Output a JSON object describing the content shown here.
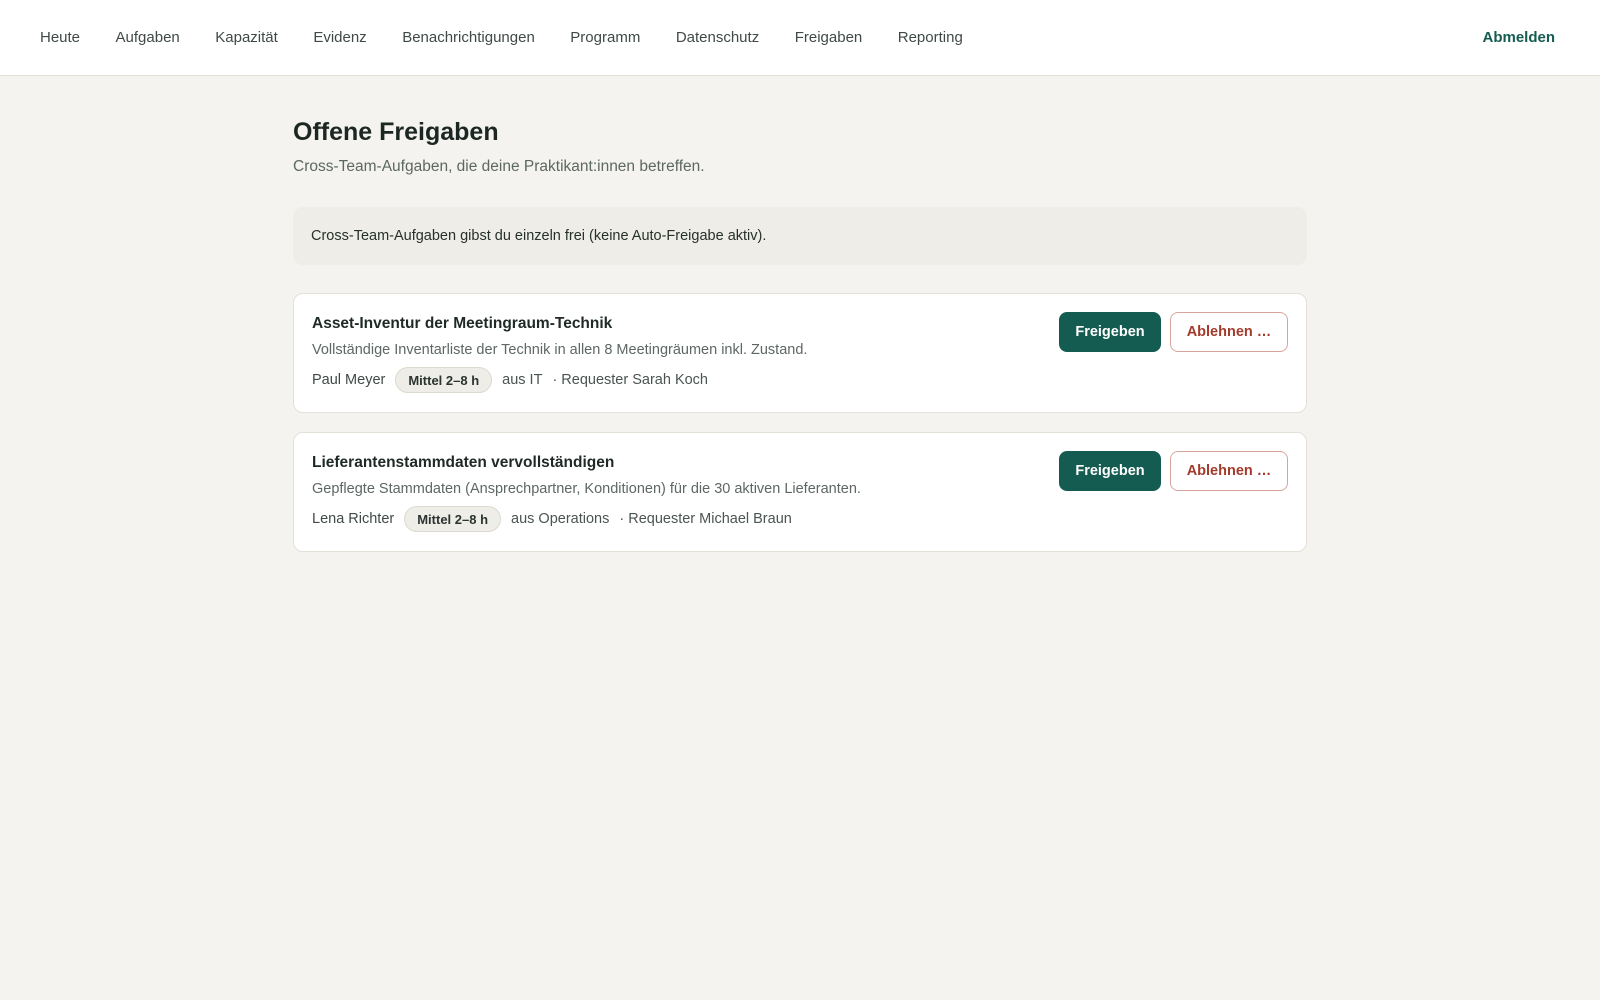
{
  "nav": {
    "items": [
      {
        "label": "Heute"
      },
      {
        "label": "Aufgaben"
      },
      {
        "label": "Kapazität"
      },
      {
        "label": "Evidenz"
      },
      {
        "label": "Benachrichtigungen"
      },
      {
        "label": "Programm"
      },
      {
        "label": "Datenschutz"
      },
      {
        "label": "Freigaben"
      },
      {
        "label": "Reporting"
      }
    ],
    "logout_label": "Abmelden"
  },
  "page": {
    "title": "Offene Freigaben",
    "subtitle": "Cross-Team-Aufgaben, die deine Praktikant:innen betreffen.",
    "notice": "Cross-Team-Aufgaben gibst du einzeln frei (keine Auto-Freigabe aktiv)."
  },
  "requests": [
    {
      "title": "Asset-Inventur der Meetingraum-Technik",
      "description": "Vollständige Inventarliste der Technik in allen 8 Meetingräumen inkl. Zustand.",
      "person": "Paul Meyer",
      "effort": "Mittel 2–8 h",
      "department": "aus IT",
      "requester": "· Requester Sarah Koch",
      "approve_label": "Freigeben",
      "reject_label": "Ablehnen …"
    },
    {
      "title": "Lieferantenstammdaten vervollständigen",
      "description": "Gepflegte Stammdaten (Ansprechpartner, Konditionen) für die 30 aktiven Lieferanten.",
      "person": "Lena Richter",
      "effort": "Mittel 2–8 h",
      "department": "aus Operations",
      "requester": "· Requester Michael Braun",
      "approve_label": "Freigeben",
      "reject_label": "Ablehnen …"
    }
  ],
  "colors": {
    "accent": "#145c52",
    "danger": "#a33b2c",
    "background": "#f4f3ef"
  }
}
